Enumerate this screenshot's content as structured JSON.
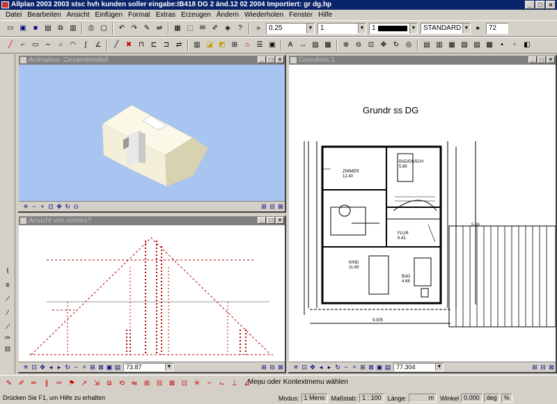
{
  "app": {
    "title": "Allplan 2003   2003 stsc hvh kunden   soller eingabe:IB418   DG 2 änd.12 02 2004  Importiert: gr dg.hp"
  },
  "menu": [
    "Datei",
    "Bearbeiten",
    "Ansicht",
    "Einfügen",
    "Format",
    "Extras",
    "Erzeugen",
    "Ändern",
    "Wiederholen",
    "Fenster",
    "Hilfe"
  ],
  "toolbar": {
    "pen_value": "0.25",
    "line_value": "1",
    "color_value": "1",
    "style_value": "STANDARD",
    "size_value": "72"
  },
  "windows": {
    "animation": {
      "title": "Animation: Gesamtmodell"
    },
    "front": {
      "title": "Ansicht von vornes?",
      "scale": "73.87"
    },
    "plan": {
      "title": "Grundriss:1",
      "scale": "77.304"
    }
  },
  "plan": {
    "heading": "Grundr ss DG",
    "rooms": [
      {
        "name": "BAD/DUSCH",
        "area": "5.86"
      },
      {
        "name": "ZIMMER",
        "area": "12.40"
      },
      {
        "name": "FLUR",
        "area": "6.42"
      },
      {
        "name": "KIND",
        "area": "11.60"
      },
      {
        "name": "BAD",
        "area": "4.68"
      }
    ],
    "dim_bottom": "9.305",
    "dim_right": "5.88"
  },
  "prompt": "Menu oder Kontextmenu wählen",
  "status": {
    "hint": "Drücken Sie F1, um Hilfe zu erhalten",
    "modus_label": "Modus:",
    "modus_value": "1 Meno",
    "scale_label": "Maßstab:",
    "scale_value": "1 : 100",
    "length_label": "Länge:",
    "length_value": "m",
    "angle_label": "Winkel",
    "angle_value": "0.000",
    "unit_value": "deg",
    "pct_value": "%"
  }
}
